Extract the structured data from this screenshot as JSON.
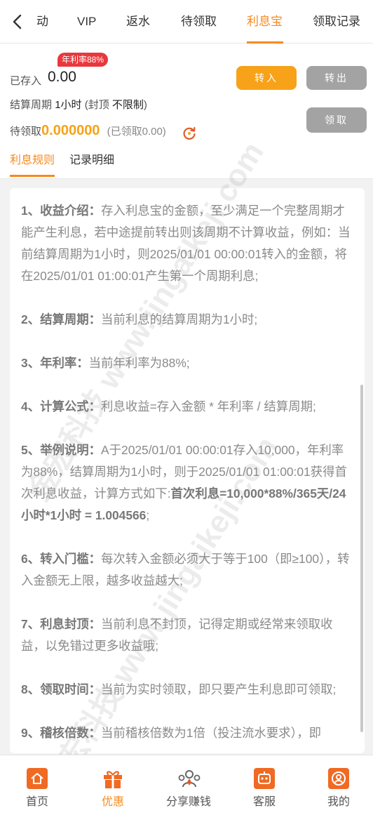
{
  "tabs": [
    {
      "label": "动",
      "name": "tab-activity"
    },
    {
      "label": "VIP",
      "name": "tab-vip"
    },
    {
      "label": "返水",
      "name": "tab-rebate"
    },
    {
      "label": "待领取",
      "name": "tab-pending"
    },
    {
      "label": "利息宝",
      "name": "tab-interest"
    },
    {
      "label": "领取记录",
      "name": "tab-claim-records"
    }
  ],
  "active_tab": "利息宝",
  "account": {
    "saved_label": "已存入",
    "saved_value": "0.00",
    "apr_badge": "年利率88%",
    "period_label": "结算周期",
    "period_value": "1小时",
    "cap_open": "(封顶",
    "cap_value": "不限制",
    "cap_close": ")",
    "pending_label": "待领取",
    "pending_value": "0.000000",
    "claimed_text": "(已领取0.00)"
  },
  "buttons": {
    "transfer_in": "转入",
    "transfer_out": "转出",
    "claim": "领取"
  },
  "subtabs": {
    "rules": "利息规则",
    "records": "记录明细"
  },
  "rules": [
    {
      "title": "1、收益介绍：",
      "text": "存入利息宝的金额，至少满足一个完整周期才能产生利息，若中途提前转出则该周期不计算收益，例如：当前结算周期为1小时，则2025/01/01 00:00:01转入的金额，将在2025/01/01 01:00:01产生第一个周期利息;"
    },
    {
      "title": "2、结算周期：",
      "text": "当前利息的结算周期为1小时;"
    },
    {
      "title": "3、年利率：",
      "text": "当前年利率为88%;"
    },
    {
      "title": "4、计算公式：",
      "text": "利息收益=存入金额 * 年利率 / 结算周期;"
    },
    {
      "title": "5、举例说明：",
      "text": "A于2025/01/01 00:00:01存入10,000，年利率为88%，结算周期为1小时，则于2025/01/01 01:00:01获得首次利息收益，计算方式如下:",
      "bold": "首次利息=10,000*88%/365天/24小时*1小时 = 1.004566",
      "tail": ";"
    },
    {
      "title": "6、转入门槛：",
      "text": "每次转入金额必须大于等于100（即≥100），转入金额无上限，越多收益越大;"
    },
    {
      "title": "7、利息封顶：",
      "text": "当前利息不封顶，记得定期或经常来领取收益，以免错过更多收益哦;"
    },
    {
      "title": "8、领取时间：",
      "text": "当前为实时领取，即只要产生利息即可领取;"
    },
    {
      "title": "9、稽核倍数：",
      "text": "当前稽核倍数为1倍（投注流水要求），即"
    }
  ],
  "watermark": "金宏科技 www.jingaikeji.com",
  "nav": [
    {
      "label": "首页",
      "icon": "home-icon"
    },
    {
      "label": "优惠",
      "icon": "gift-icon"
    },
    {
      "label": "分享赚钱",
      "icon": "share-icon"
    },
    {
      "label": "客服",
      "icon": "support-icon"
    },
    {
      "label": "我的",
      "icon": "profile-icon"
    }
  ],
  "colors": {
    "accent": "#f58a1f",
    "amount": "#f7a218",
    "badge": "#e8383d",
    "button_gray": "#a3a3a3"
  }
}
